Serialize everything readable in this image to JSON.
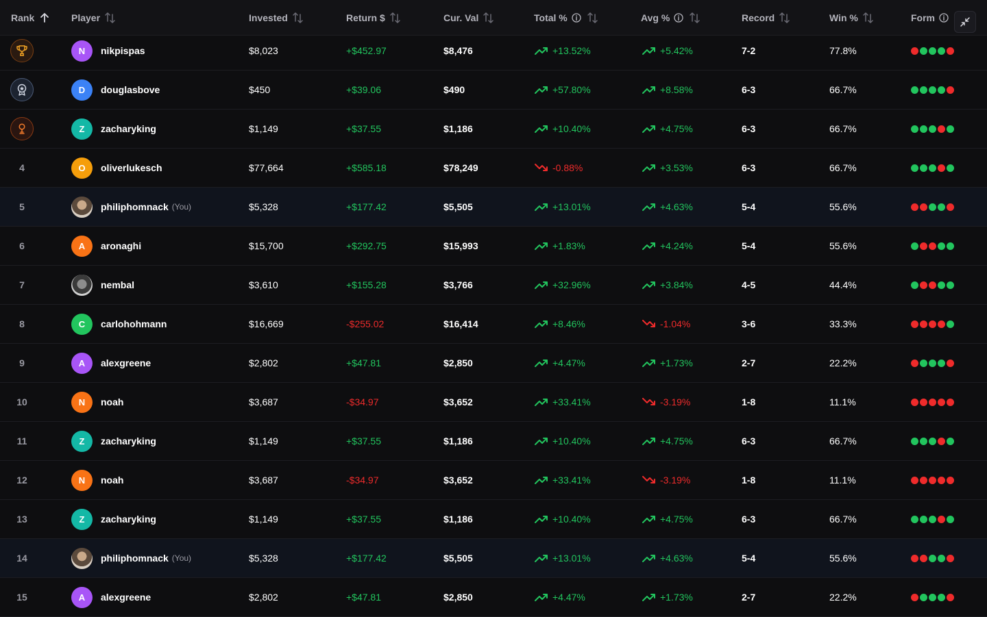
{
  "colors": {
    "positive": "#22c55e",
    "negative": "#ef2b2b",
    "win": "#22c55e",
    "loss": "#ef2b2b"
  },
  "header": {
    "rank": "Rank",
    "player": "Player",
    "invested": "Invested",
    "return": "Return $",
    "cur_val": "Cur. Val",
    "total_pct": "Total %",
    "avg_pct": "Avg %",
    "record": "Record",
    "win_pct": "Win %",
    "form": "Form"
  },
  "rows": [
    {
      "rank": "1",
      "medal": "gold-trophy-icon",
      "initial": "N",
      "avatar_color": "#a855f7",
      "avatar_type": "letter",
      "name": "nikpispas",
      "you": "",
      "invested": "$8,023",
      "return": "+$452.97",
      "return_dir": "up",
      "cur_val": "$8,476",
      "total": "+13.52%",
      "total_dir": "up",
      "avg": "+5.42%",
      "avg_dir": "up",
      "record": "7-2",
      "win": "77.8%",
      "form": [
        "l",
        "w",
        "w",
        "w",
        "l"
      ]
    },
    {
      "rank": "2",
      "medal": "silver-medal-icon",
      "initial": "D",
      "avatar_color": "#3b82f6",
      "avatar_type": "letter",
      "name": "douglasbove",
      "you": "",
      "invested": "$450",
      "return": "+$39.06",
      "return_dir": "up",
      "cur_val": "$490",
      "total": "+57.80%",
      "total_dir": "up",
      "avg": "+8.58%",
      "avg_dir": "up",
      "record": "6-3",
      "win": "66.7%",
      "form": [
        "w",
        "w",
        "w",
        "w",
        "l"
      ]
    },
    {
      "rank": "3",
      "medal": "bronze-medal-icon",
      "initial": "Z",
      "avatar_color": "#14b8a6",
      "avatar_type": "letter",
      "name": "zacharyking",
      "you": "",
      "invested": "$1,149",
      "return": "+$37.55",
      "return_dir": "up",
      "cur_val": "$1,186",
      "total": "+10.40%",
      "total_dir": "up",
      "avg": "+4.75%",
      "avg_dir": "up",
      "record": "6-3",
      "win": "66.7%",
      "form": [
        "w",
        "w",
        "w",
        "l",
        "w"
      ]
    },
    {
      "rank": "4",
      "medal": "",
      "initial": "O",
      "avatar_color": "#f59e0b",
      "avatar_type": "letter",
      "name": "oliverlukesch",
      "you": "",
      "invested": "$77,664",
      "return": "+$585.18",
      "return_dir": "up",
      "cur_val": "$78,249",
      "total": "-0.88%",
      "total_dir": "down",
      "avg": "+3.53%",
      "avg_dir": "up",
      "record": "6-3",
      "win": "66.7%",
      "form": [
        "w",
        "w",
        "w",
        "l",
        "w"
      ]
    },
    {
      "rank": "5",
      "medal": "",
      "initial": "",
      "avatar_color": "",
      "avatar_type": "photo",
      "name": "philiphomnack",
      "you": "(You)",
      "invested": "$5,328",
      "return": "+$177.42",
      "return_dir": "up",
      "cur_val": "$5,505",
      "total": "+13.01%",
      "total_dir": "up",
      "avg": "+4.63%",
      "avg_dir": "up",
      "record": "5-4",
      "win": "55.6%",
      "form": [
        "l",
        "l",
        "w",
        "w",
        "l"
      ]
    },
    {
      "rank": "6",
      "medal": "",
      "initial": "A",
      "avatar_color": "#f97316",
      "avatar_type": "letter",
      "name": "aronaghi",
      "you": "",
      "invested": "$15,700",
      "return": "+$292.75",
      "return_dir": "up",
      "cur_val": "$15,993",
      "total": "+1.83%",
      "total_dir": "up",
      "avg": "+4.24%",
      "avg_dir": "up",
      "record": "5-4",
      "win": "55.6%",
      "form": [
        "w",
        "l",
        "l",
        "w",
        "w"
      ]
    },
    {
      "rank": "7",
      "medal": "",
      "initial": "",
      "avatar_color": "",
      "avatar_type": "photo2",
      "name": "nembal",
      "you": "",
      "invested": "$3,610",
      "return": "+$155.28",
      "return_dir": "up",
      "cur_val": "$3,766",
      "total": "+32.96%",
      "total_dir": "up",
      "avg": "+3.84%",
      "avg_dir": "up",
      "record": "4-5",
      "win": "44.4%",
      "form": [
        "w",
        "l",
        "l",
        "w",
        "w"
      ]
    },
    {
      "rank": "8",
      "medal": "",
      "initial": "C",
      "avatar_color": "#22c55e",
      "avatar_type": "letter",
      "name": "carlohohmann",
      "you": "",
      "invested": "$16,669",
      "return": "-$255.02",
      "return_dir": "down",
      "cur_val": "$16,414",
      "total": "+8.46%",
      "total_dir": "up",
      "avg": "-1.04%",
      "avg_dir": "down",
      "record": "3-6",
      "win": "33.3%",
      "form": [
        "l",
        "l",
        "l",
        "l",
        "w"
      ]
    },
    {
      "rank": "9",
      "medal": "",
      "initial": "A",
      "avatar_color": "#a855f7",
      "avatar_type": "letter",
      "name": "alexgreene",
      "you": "",
      "invested": "$2,802",
      "return": "+$47.81",
      "return_dir": "up",
      "cur_val": "$2,850",
      "total": "+4.47%",
      "total_dir": "up",
      "avg": "+1.73%",
      "avg_dir": "up",
      "record": "2-7",
      "win": "22.2%",
      "form": [
        "l",
        "w",
        "w",
        "w",
        "l"
      ]
    },
    {
      "rank": "10",
      "medal": "",
      "initial": "N",
      "avatar_color": "#f97316",
      "avatar_type": "letter",
      "name": "noah",
      "you": "",
      "invested": "$3,687",
      "return": "-$34.97",
      "return_dir": "down",
      "cur_val": "$3,652",
      "total": "+33.41%",
      "total_dir": "up",
      "avg": "-3.19%",
      "avg_dir": "down",
      "record": "1-8",
      "win": "11.1%",
      "form": [
        "l",
        "l",
        "l",
        "l",
        "l"
      ]
    },
    {
      "rank": "11",
      "medal": "",
      "initial": "Z",
      "avatar_color": "#14b8a6",
      "avatar_type": "letter",
      "name": "zacharyking",
      "you": "",
      "invested": "$1,149",
      "return": "+$37.55",
      "return_dir": "up",
      "cur_val": "$1,186",
      "total": "+10.40%",
      "total_dir": "up",
      "avg": "+4.75%",
      "avg_dir": "up",
      "record": "6-3",
      "win": "66.7%",
      "form": [
        "w",
        "w",
        "w",
        "l",
        "w"
      ]
    },
    {
      "rank": "12",
      "medal": "",
      "initial": "N",
      "avatar_color": "#f97316",
      "avatar_type": "letter",
      "name": "noah",
      "you": "",
      "invested": "$3,687",
      "return": "-$34.97",
      "return_dir": "down",
      "cur_val": "$3,652",
      "total": "+33.41%",
      "total_dir": "up",
      "avg": "-3.19%",
      "avg_dir": "down",
      "record": "1-8",
      "win": "11.1%",
      "form": [
        "l",
        "l",
        "l",
        "l",
        "l"
      ]
    },
    {
      "rank": "13",
      "medal": "",
      "initial": "Z",
      "avatar_color": "#14b8a6",
      "avatar_type": "letter",
      "name": "zacharyking",
      "you": "",
      "invested": "$1,149",
      "return": "+$37.55",
      "return_dir": "up",
      "cur_val": "$1,186",
      "total": "+10.40%",
      "total_dir": "up",
      "avg": "+4.75%",
      "avg_dir": "up",
      "record": "6-3",
      "win": "66.7%",
      "form": [
        "w",
        "w",
        "w",
        "l",
        "w"
      ]
    },
    {
      "rank": "14",
      "medal": "",
      "initial": "",
      "avatar_color": "",
      "avatar_type": "photo",
      "name": "philiphomnack",
      "you": "(You)",
      "invested": "$5,328",
      "return": "+$177.42",
      "return_dir": "up",
      "cur_val": "$5,505",
      "total": "+13.01%",
      "total_dir": "up",
      "avg": "+4.63%",
      "avg_dir": "up",
      "record": "5-4",
      "win": "55.6%",
      "form": [
        "l",
        "l",
        "w",
        "w",
        "l"
      ]
    },
    {
      "rank": "15",
      "medal": "",
      "initial": "A",
      "avatar_color": "#a855f7",
      "avatar_type": "letter",
      "name": "alexgreene",
      "you": "",
      "invested": "$2,802",
      "return": "+$47.81",
      "return_dir": "up",
      "cur_val": "$2,850",
      "total": "+4.47%",
      "total_dir": "up",
      "avg": "+1.73%",
      "avg_dir": "up",
      "record": "2-7",
      "win": "22.2%",
      "form": [
        "l",
        "w",
        "w",
        "w",
        "l"
      ]
    }
  ]
}
